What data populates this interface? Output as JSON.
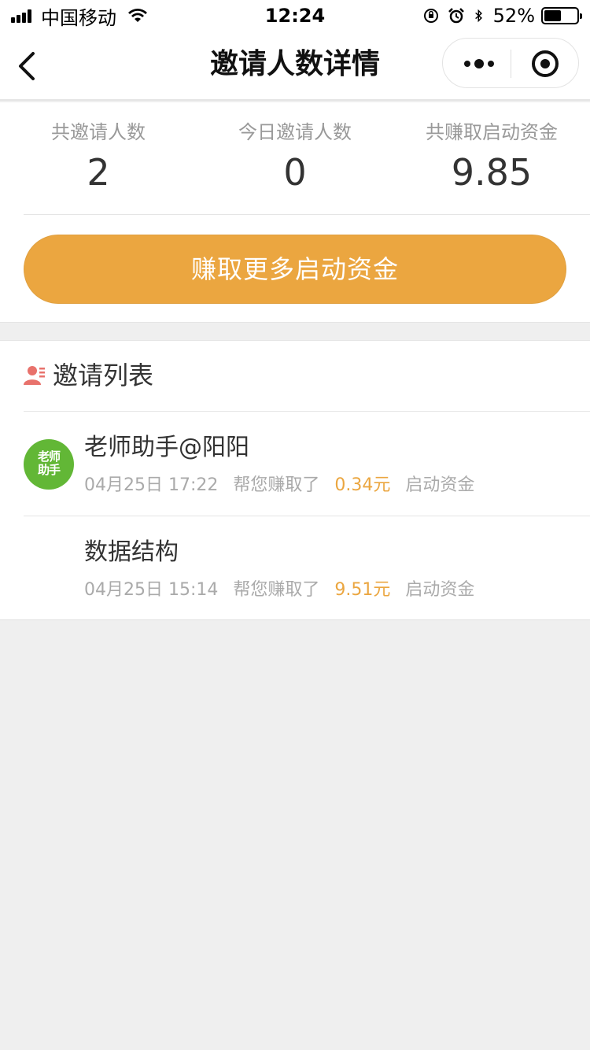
{
  "status_bar": {
    "carrier": "中国移动",
    "time": "12:24",
    "battery": "52%",
    "battery_level": 0.52
  },
  "nav": {
    "title": "邀请人数详情"
  },
  "stats": [
    {
      "label": "共邀请人数",
      "value": "2"
    },
    {
      "label": "今日邀请人数",
      "value": "0"
    },
    {
      "label": "共赚取启动资金",
      "value": "9.85"
    }
  ],
  "earn_button": "赚取更多启动资金",
  "list": {
    "title": "邀请列表",
    "items": [
      {
        "avatar_text_1": "老师",
        "avatar_text_2": "助手",
        "name": "老师助手@阳阳",
        "date": "04月25日 17:22",
        "prefix": "帮您赚取了",
        "amount": "0.34元",
        "suffix": "启动资金"
      },
      {
        "name": "数据结构",
        "date": "04月25日 15:14",
        "prefix": "帮您赚取了",
        "amount": "9.51元",
        "suffix": "启动资金"
      }
    ]
  },
  "colors": {
    "accent": "#eba640",
    "avatar_green": "#62b736"
  }
}
